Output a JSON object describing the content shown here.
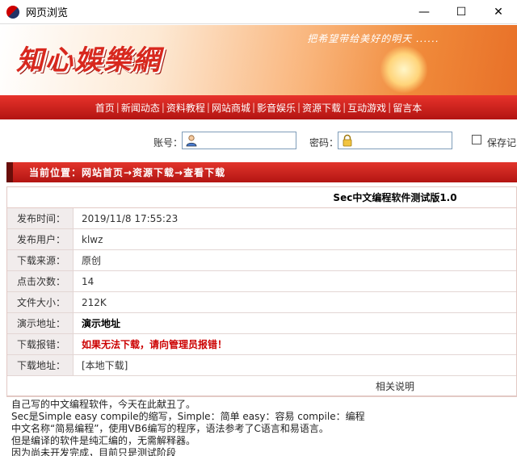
{
  "window": {
    "title": "网页浏览",
    "controls": [
      "—",
      "☐",
      "✕"
    ]
  },
  "banner": {
    "logo": "知心娛樂網",
    "slogan": "把希望带给美好的明天 ......"
  },
  "nav": [
    "首页",
    "新闻动态",
    "资料教程",
    "网站商城",
    "影音娱乐",
    "资源下载",
    "互动游戏",
    "留言本"
  ],
  "login": {
    "account_label": "账号：",
    "password_label": "密码：",
    "remember_label": "保存记"
  },
  "breadcrumb": "当前位置：网站首页→资源下载→查看下载",
  "detail": {
    "title": "Sec中文编程软件测试版1.0",
    "rows": [
      {
        "key": "发布时间：",
        "value": "2019/11/8 17:55:23"
      },
      {
        "key": "发布用户：",
        "value": "klwz"
      },
      {
        "key": "下载来源：",
        "value": "原创"
      },
      {
        "key": "点击次数：",
        "value": "14"
      },
      {
        "key": "文件大小：",
        "value": "212K"
      },
      {
        "key": "演示地址：",
        "value": "演示地址"
      },
      {
        "key": "下载报错：",
        "value": "如果无法下载，请向管理员报错！"
      },
      {
        "key": "下载地址：",
        "value": "[本地下载]"
      }
    ],
    "related_label": "相关说明"
  },
  "description": [
    "自己写的中文编程软件，今天在此献丑了。",
    "Sec是Simple easy compile的缩写，Simple：简单 easy：容易 compile：编程",
    "中文名称“简易编程”，使用VB6编写的程序，语法参考了C语言和易语言。",
    "但是编译的软件是纯汇编的，无需解释器。",
    "因为尚未开发完成，目前只是测试阶段"
  ]
}
